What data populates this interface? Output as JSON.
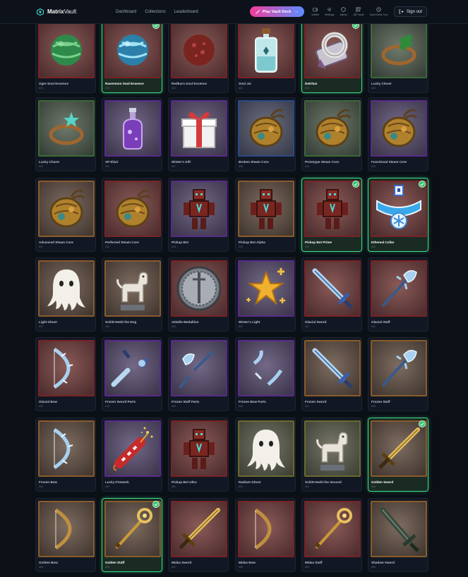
{
  "nav": {
    "brand_bold": "Matrix",
    "brand_rest": "Vault",
    "links": [
      "Dashboard",
      "Collections",
      "Leaderboard"
    ],
    "play_button": "Play Vault Deck",
    "icon_links": [
      {
        "label": "Wallet",
        "icon": "wallet-icon"
      },
      {
        "label": "Settings",
        "icon": "gear-icon"
      },
      {
        "label": "Admin",
        "icon": "shield-icon"
      },
      {
        "label": "QR Vault",
        "icon": "qr-icon"
      },
      {
        "label": "Vault Deck Tour",
        "icon": "clock-icon"
      }
    ],
    "sign_out": "Sign out"
  },
  "colors": {
    "accent_pink": "#f23d9a",
    "accent_blue": "#5b8dff",
    "owned_green": "#3ee08a"
  },
  "items": [
    {
      "name": "Ogre Soul Essence",
      "num": "#19",
      "rarity": "red",
      "icon": "green-orb",
      "owned": false
    },
    {
      "name": "Ravenmon Soul Essence",
      "num": "#20",
      "rarity": "red",
      "icon": "blue-orb",
      "owned": true
    },
    {
      "name": "Redborn Soul Essence",
      "num": "#21",
      "rarity": "red",
      "icon": "red-orb",
      "owned": false
    },
    {
      "name": "Soul Jar",
      "num": "#22",
      "rarity": "red",
      "icon": "soul-jar",
      "owned": false
    },
    {
      "name": "Detritus",
      "num": "#23",
      "rarity": "red",
      "icon": "scroll-ring",
      "owned": true
    },
    {
      "name": "Lucky Clover",
      "num": "#24",
      "rarity": "green",
      "icon": "clover-ring",
      "owned": false
    },
    {
      "name": "Lucky Charm",
      "num": "#25",
      "rarity": "green",
      "icon": "star-ring",
      "owned": false
    },
    {
      "name": "XP Elixir",
      "num": "#26",
      "rarity": "purple",
      "icon": "potion",
      "owned": false
    },
    {
      "name": "Winter's Gift",
      "num": "#27",
      "rarity": "purple",
      "icon": "gift",
      "owned": false
    },
    {
      "name": "Broken Steam Core",
      "num": "#28",
      "rarity": "blue",
      "icon": "steam-core",
      "owned": false
    },
    {
      "name": "Prototype Steam Core",
      "num": "#29",
      "rarity": "green",
      "icon": "steam-core",
      "owned": false
    },
    {
      "name": "Functional Steam Core",
      "num": "#30",
      "rarity": "purple",
      "icon": "steam-core",
      "owned": false
    },
    {
      "name": "Advanced Steam Core",
      "num": "#31",
      "rarity": "gold",
      "icon": "steam-core",
      "owned": false
    },
    {
      "name": "Perfected Steam Core",
      "num": "#32",
      "rarity": "red",
      "icon": "steam-core",
      "owned": false
    },
    {
      "name": "Pickup Bot",
      "num": "#33",
      "rarity": "purple",
      "icon": "robot",
      "owned": false
    },
    {
      "name": "Pickup Bot Alpha",
      "num": "#34",
      "rarity": "gold",
      "icon": "robot",
      "owned": false
    },
    {
      "name": "Pickup Bot Prime",
      "num": "#35",
      "rarity": "red",
      "icon": "robot",
      "owned": true
    },
    {
      "name": "Ethereal Collar",
      "num": "#36",
      "rarity": "red",
      "icon": "collar",
      "owned": true
    },
    {
      "name": "Light Ghost",
      "num": "#37",
      "rarity": "gold",
      "icon": "ghost",
      "owned": false
    },
    {
      "name": "Schitt-Hedd the Dog",
      "num": "#38",
      "rarity": "gold",
      "icon": "dog-statue",
      "owned": false
    },
    {
      "name": "Volatile Medallion",
      "num": "#39",
      "rarity": "red",
      "icon": "medallion",
      "owned": false
    },
    {
      "name": "Winter's Light",
      "num": "#40",
      "rarity": "purple",
      "icon": "star",
      "owned": false
    },
    {
      "name": "Glacial Sword",
      "num": "#41",
      "rarity": "red",
      "icon": "ice-sword",
      "owned": false
    },
    {
      "name": "Glacial Staff",
      "num": "#42",
      "rarity": "red",
      "icon": "ice-staff",
      "owned": false
    },
    {
      "name": "Glacial Bow",
      "num": "#43",
      "rarity": "red",
      "icon": "ice-bow",
      "owned": false
    },
    {
      "name": "Frozen Sword Parts",
      "num": "#44",
      "rarity": "purple",
      "icon": "sword-parts",
      "owned": false
    },
    {
      "name": "Frozen Staff Parts",
      "num": "#45",
      "rarity": "purple",
      "icon": "staff-parts",
      "owned": false
    },
    {
      "name": "Frozen Bow Parts",
      "num": "#46",
      "rarity": "purple",
      "icon": "bow-parts",
      "owned": false
    },
    {
      "name": "Frozen Sword",
      "num": "#47",
      "rarity": "gold",
      "icon": "ice-sword",
      "owned": false
    },
    {
      "name": "Frozen Staff",
      "num": "#48",
      "rarity": "gold",
      "icon": "ice-staff",
      "owned": false
    },
    {
      "name": "Frozen Bow",
      "num": "#49",
      "rarity": "gold",
      "icon": "ice-bow",
      "owned": false
    },
    {
      "name": "Lucky Firework",
      "num": "#50",
      "rarity": "purple",
      "icon": "firework",
      "owned": false
    },
    {
      "name": "Pickup Bot Ultra",
      "num": "#51",
      "rarity": "red",
      "icon": "robot",
      "owned": false
    },
    {
      "name": "Radiant Ghost",
      "num": "#52",
      "rarity": "olive",
      "icon": "ghost",
      "owned": false
    },
    {
      "name": "Schitt-Hedd the Second",
      "num": "#53",
      "rarity": "olive",
      "icon": "dog-statue",
      "owned": false
    },
    {
      "name": "Golden Sword",
      "num": "#54",
      "rarity": "gold",
      "icon": "gold-sword",
      "owned": true
    },
    {
      "name": "Golden Bow",
      "num": "#55",
      "rarity": "gold",
      "icon": "gold-bow",
      "owned": false
    },
    {
      "name": "Golden Staff",
      "num": "#56",
      "rarity": "gold",
      "icon": "gold-staff",
      "owned": true
    },
    {
      "name": "Midas Sword",
      "num": "#57",
      "rarity": "red",
      "icon": "gold-sword",
      "owned": false
    },
    {
      "name": "Midas Bow",
      "num": "#58",
      "rarity": "red",
      "icon": "gold-bow",
      "owned": false
    },
    {
      "name": "Midas Staff",
      "num": "#59",
      "rarity": "red",
      "icon": "gold-staff",
      "owned": false
    },
    {
      "name": "Shadow Sword",
      "num": "#60",
      "rarity": "gold",
      "icon": "shadow-sword",
      "owned": false
    }
  ]
}
